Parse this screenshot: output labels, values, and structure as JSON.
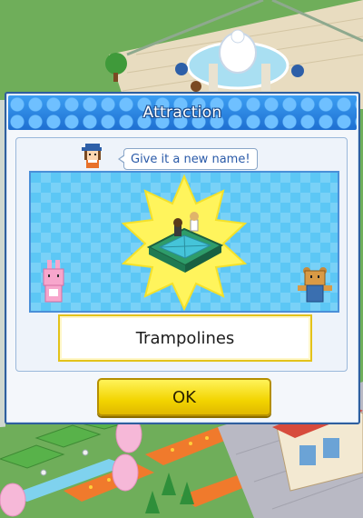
{
  "dialog": {
    "title": "Attraction",
    "speech_bubble": "Give it a new name!",
    "name_value": "Trampolines",
    "ok_label": "OK"
  },
  "icons": {
    "guide": "staff-avatar-icon",
    "attraction": "trampolines-attraction-icon",
    "mascot_left": "pink-rabbit-mascot-icon",
    "mascot_right": "bear-mascot-icon"
  },
  "colors": {
    "title_bar": "#2a86e6",
    "ok_button": "#f2d400",
    "preview_bg": "#5cc7f5",
    "burst": "#fff45c"
  }
}
